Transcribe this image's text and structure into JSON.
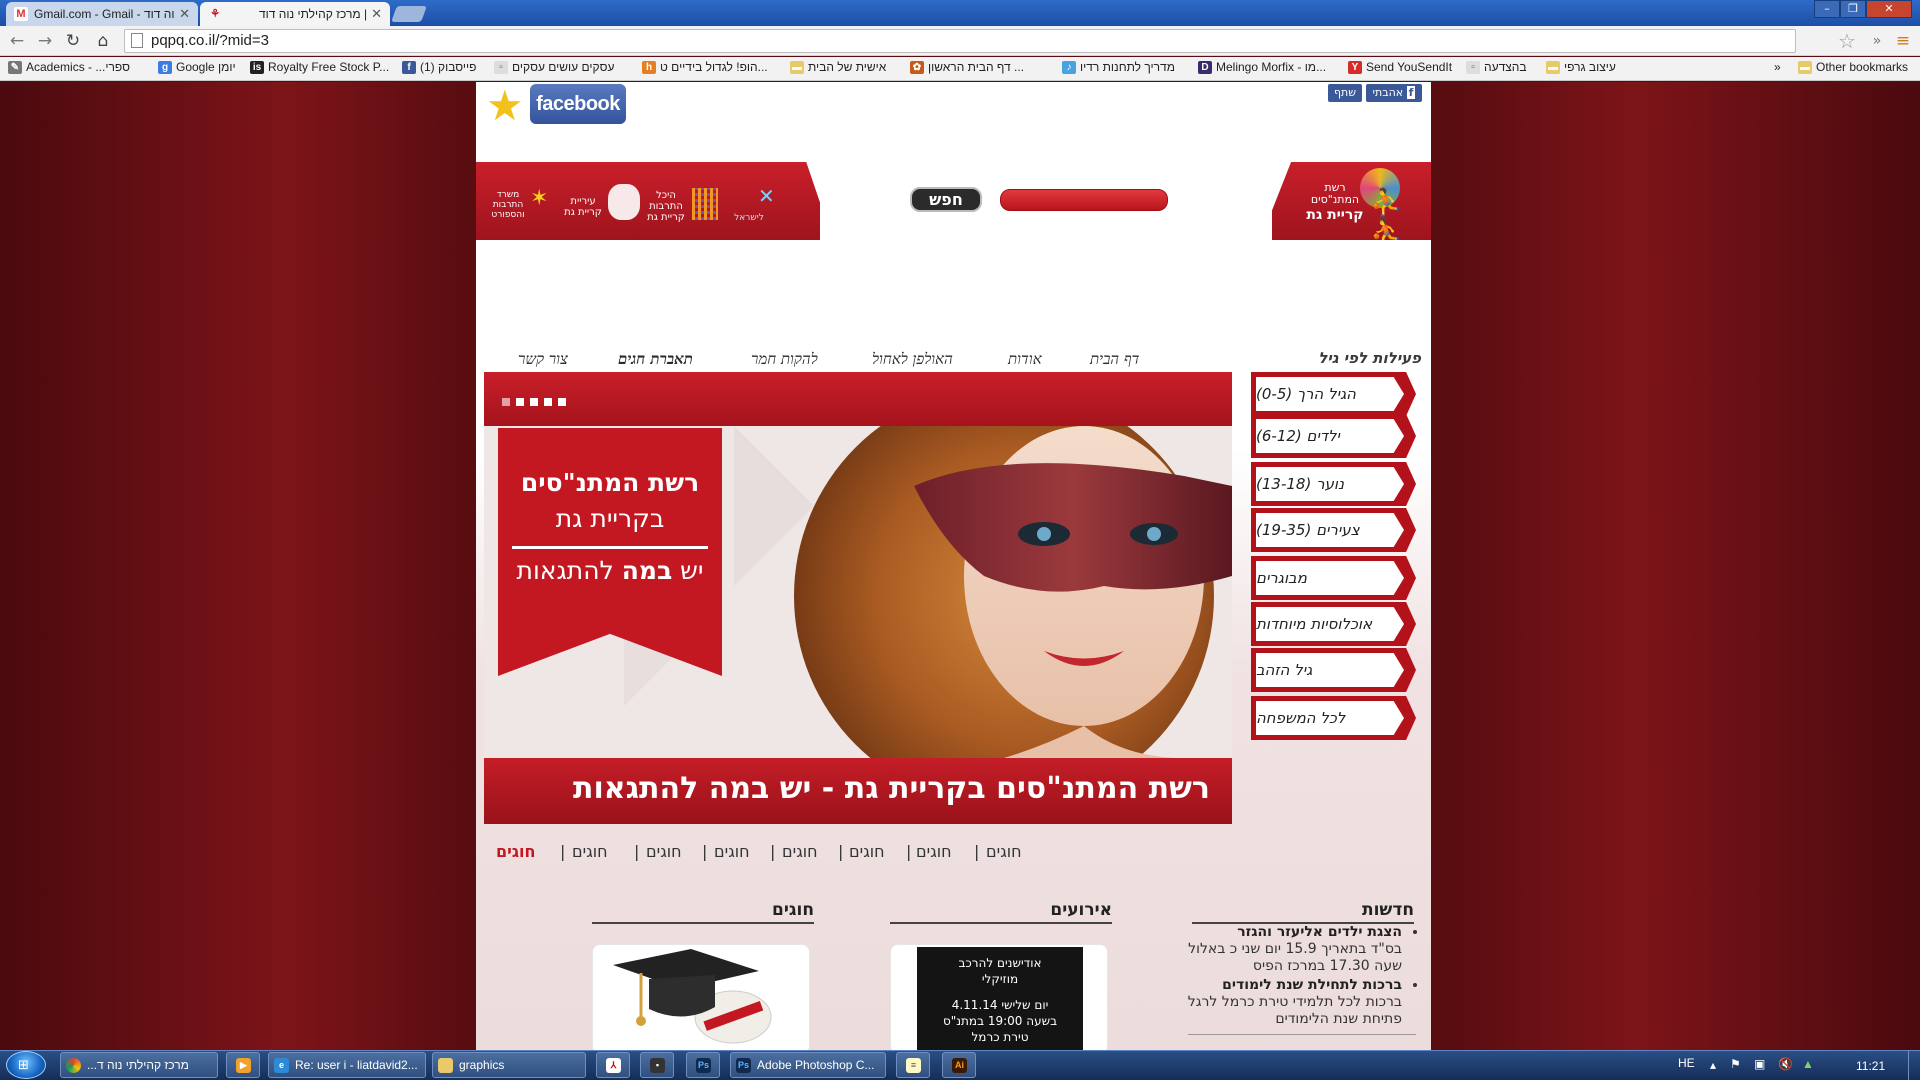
{
  "browser": {
    "tabs": [
      {
        "label": "Gmail.com - Gmail - נוה דוד",
        "favicon": "M"
      },
      {
        "label": "| מרכז קהילתי נוה דוד",
        "favicon": "⚘"
      }
    ],
    "window_buttons": [
      "–",
      "❐",
      "✕"
    ],
    "url": "pqpq.co.il/?mid=3",
    "nav_icons": [
      "back-icon",
      "forward-icon",
      "reload-icon",
      "home-icon"
    ],
    "bookmarks": [
      {
        "label": "Academics - ...ספרי",
        "icon": "pen"
      },
      {
        "label": "Google יומן",
        "icon": "google"
      },
      {
        "label": "Royalty Free Stock P...",
        "icon": "stock"
      },
      {
        "label": "(1) פייסבוק",
        "icon": "facebook"
      },
      {
        "label": "עסקים עושים עסקים",
        "icon": "page"
      },
      {
        "label": "הופ! לגדול בידיים ט...",
        "icon": "hop"
      },
      {
        "label": "אישית של הבית",
        "icon": "folder"
      },
      {
        "label": "דף הבית הראשון ...",
        "icon": "leaf"
      },
      {
        "label": "מדריך לתחנות רדיו",
        "icon": "radio"
      },
      {
        "label": "Melingo Morfix - מו...",
        "icon": "melingo"
      },
      {
        "label": "Send YouSendIt",
        "icon": "ysi"
      },
      {
        "label": "בהצדעה",
        "icon": "page"
      },
      {
        "label": "עיצוב גרפי",
        "icon": "folder"
      }
    ],
    "bookmarks_more": "»",
    "other_bookmarks": "Other bookmarks"
  },
  "header": {
    "facebook_label": "facebook",
    "like_button": "אהבתי",
    "share_button": "שתף",
    "logo_right": {
      "line1": "רשת",
      "line2": "המתנ\"סים",
      "line3": "קריית גת"
    },
    "logo_left": [
      "משרד התרבות והספורט",
      "עיריית קריית גת",
      "היכל התרבות קריית גת",
      "לישראל"
    ],
    "search_button": "חפש"
  },
  "main_nav": [
    {
      "label": "דף הבית",
      "active": false
    },
    {
      "label": "אודות",
      "active": false
    },
    {
      "label": "האולפן לאחול",
      "active": false
    },
    {
      "label": "להקות חמר",
      "active": false
    },
    {
      "label": "תאברת חגים",
      "active": true
    },
    {
      "label": "צור קשר",
      "active": false
    }
  ],
  "age_menu": {
    "title": "פעילות לפי גיל",
    "items": [
      "הגיל הרך (0-5)",
      "ילדים (6-12)",
      "נוער (13-18)",
      "צעירים (19-35)",
      "מבוגרים",
      "אוכלוסיות מיוחדות",
      "גיל הזהב",
      "לכל המשפחה"
    ]
  },
  "slider": {
    "dot_count": 5,
    "ribbon_line1": "רשת המתנ\"סים",
    "ribbon_line2": "בקריית גת",
    "ribbon_line3_a": "יש ",
    "ribbon_line3_b": "במה",
    "ribbon_line3_c": " להתגאות",
    "caption": "רשת המתנ\"סים בקריית גת - יש במה להתגאות"
  },
  "sub_nav": {
    "items": [
      "חוגים",
      "חוגים",
      "חוגים",
      "חוגים",
      "חוגים",
      "חוגים",
      "חוגים",
      "חוגים"
    ],
    "active_index": 7,
    "separator": "|"
  },
  "sections": {
    "news": {
      "title": "חדשות",
      "items": [
        {
          "headline": "הצגת ילדים אליעזר והגזר",
          "body": "בס\"ד בתאריך 15.9 יום שני כ באלול שעה 17.30 במרכז הפיס"
        },
        {
          "headline": "ברכות לתחילת שנת לימודים",
          "body": "ברכות לכל תלמידי טירת כרמל לרגל פתיחת שנת הלימודים"
        }
      ]
    },
    "events": {
      "title": "אירועים",
      "card_lines": [
        "אודישנים להרכב",
        "מוזיקלי",
        "",
        "יום שלישי 4.11.14",
        "בשעה 19:00 במתנ\"ס",
        "טירת כרמל"
      ]
    },
    "courses": {
      "title": "חוגים"
    }
  },
  "taskbar": {
    "items": [
      {
        "label": "מרכז קהילתי נוה ד...",
        "icon": "chrome"
      },
      {
        "label": "",
        "icon": "media"
      },
      {
        "label": "Re: user i - liatdavid2...",
        "icon": "ie"
      },
      {
        "label": "graphics",
        "icon": "folder"
      },
      {
        "label": "",
        "icon": "acrobat"
      },
      {
        "label": "",
        "icon": "app"
      },
      {
        "label": "",
        "icon": "ps"
      },
      {
        "label": "Adobe Photoshop C...",
        "icon": "ps"
      },
      {
        "label": "",
        "icon": "notepad"
      },
      {
        "label": "",
        "icon": "ai"
      }
    ],
    "language": "HE",
    "time": "11:21"
  }
}
